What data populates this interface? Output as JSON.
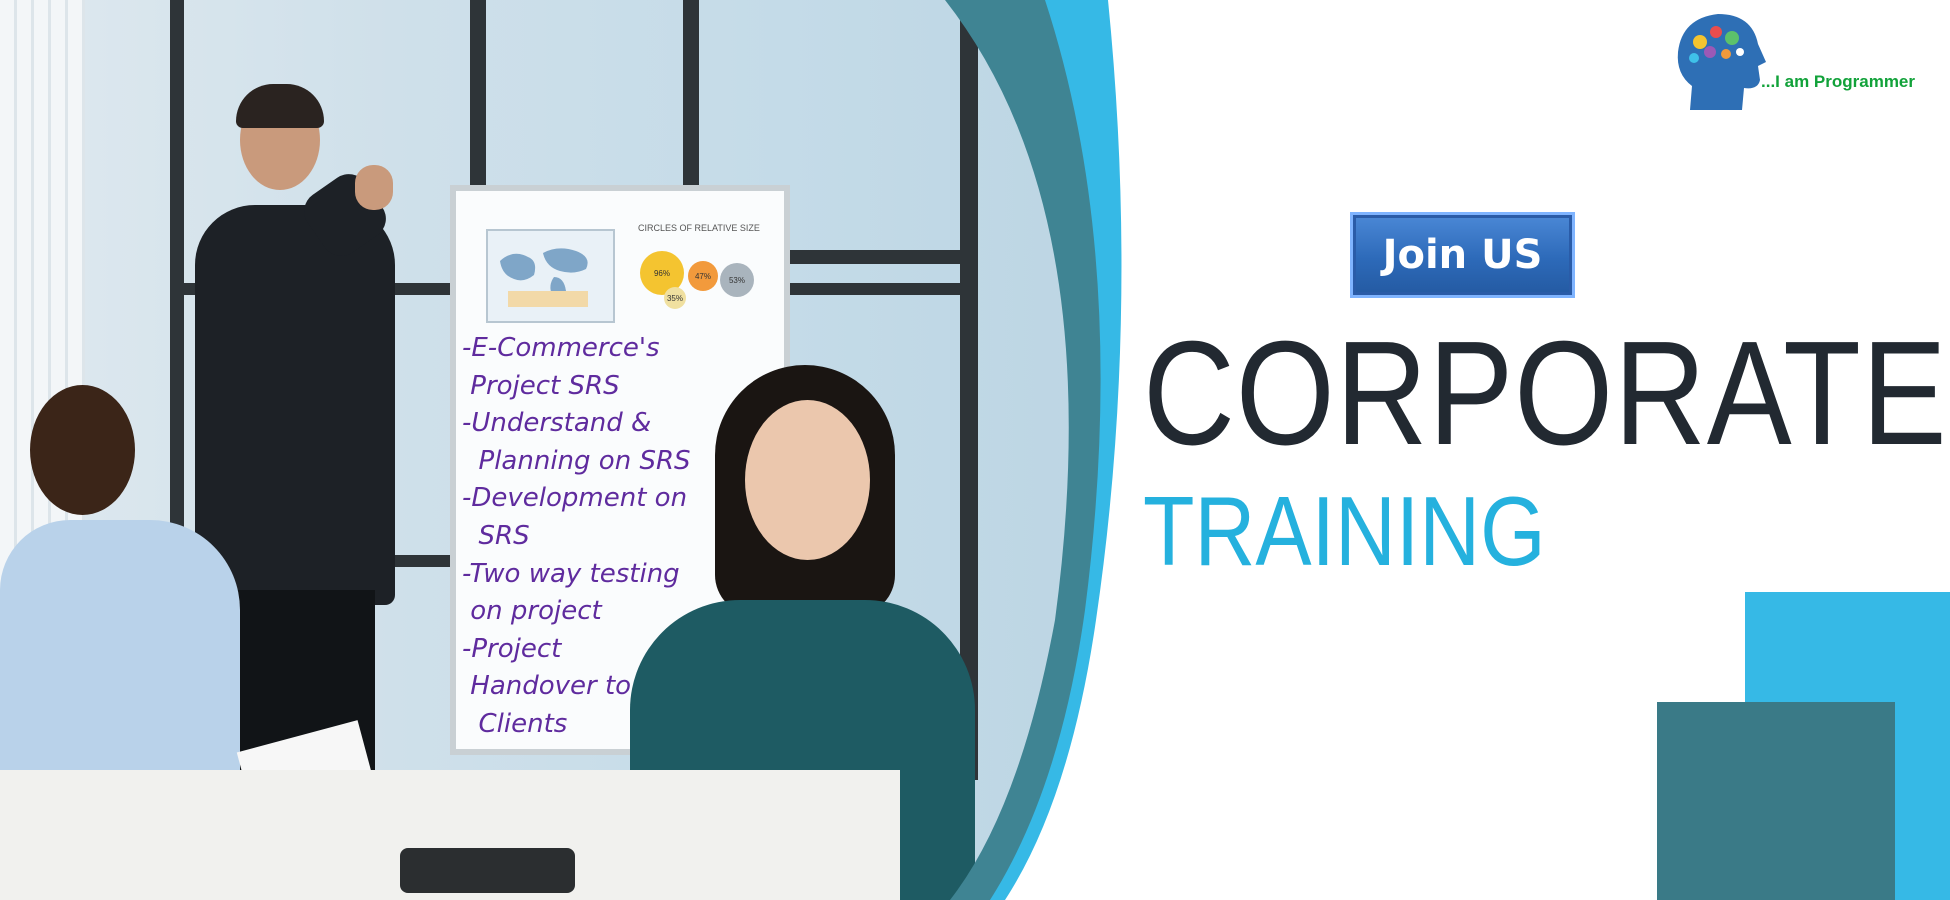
{
  "logo": {
    "icon": "brain-head-icon",
    "text": "...I am Programmer",
    "text_color": "#12a23a",
    "head_color": "#2e6fb5"
  },
  "cta": {
    "label": "Join US"
  },
  "headline": {
    "line1": "CORPORATE",
    "line2": "TRAINING",
    "line1_color": "#222931",
    "line2_color": "#25b1de"
  },
  "whiteboard": {
    "chart_title": "CIRCLES OF RELATIVE SIZE",
    "bubbles": [
      "96%",
      "47%",
      "53%",
      "35%"
    ]
  },
  "course_topics": [
    "-E-Commerce's",
    " Project SRS",
    "-Understand &",
    "  Planning on SRS",
    "-Development on",
    "  SRS",
    "-Two way testing",
    " on project",
    "-Project",
    " Handover to",
    "  Clients"
  ],
  "colors": {
    "accent_blue": "#25b1de",
    "teal": "#3a7a87",
    "sky": "#36b9e6",
    "note_purple": "#5f2b9e"
  }
}
